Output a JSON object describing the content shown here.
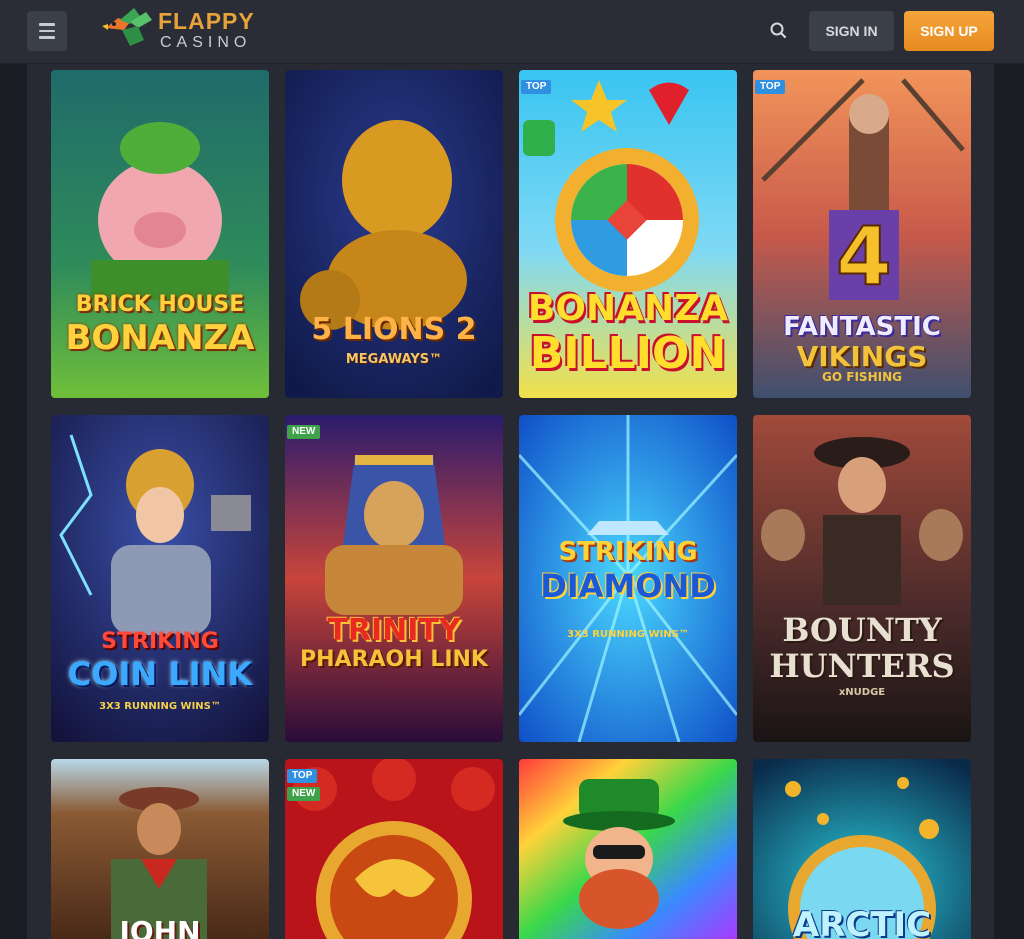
{
  "header": {
    "logo_line1": "FLAPPY",
    "logo_line2": "CASINO",
    "signin_label": "SIGN IN",
    "signup_label": "SIGN UP"
  },
  "colors": {
    "accent": "#f29b2e",
    "badge_top": "#2f8fe0",
    "badge_new": "#3fa14a"
  },
  "games": [
    {
      "line1": "BRICK HOUSE",
      "line2": "BONANZA",
      "sub": "",
      "badges": []
    },
    {
      "line1": "5 LIONS 2",
      "line2": "MEGAWAYS™",
      "sub": "",
      "badges": []
    },
    {
      "line1": "BONANZA",
      "line2": "BILLION",
      "sub": "",
      "badges": [
        "TOP"
      ]
    },
    {
      "line1": "FANTASTIC",
      "line2": "VIKINGS",
      "sub": "GO FISHING",
      "badges": [
        "TOP"
      ]
    },
    {
      "line1": "STRIKING",
      "line2": "COIN LINK",
      "sub": "3X3 RUNNING WINS™",
      "badges": []
    },
    {
      "line1": "TRINITY",
      "line2": "PHARAOH LINK",
      "sub": "",
      "badges": [
        "NEW"
      ]
    },
    {
      "line1": "STRIKING",
      "line2": "DIAMOND",
      "sub": "3X3 RUNNING WINS™",
      "badges": []
    },
    {
      "line1": "BOUNTY",
      "line2": "HUNTERS",
      "sub": "xNUDGE",
      "badges": []
    },
    {
      "line1": "JOHN",
      "line2": "",
      "sub": "",
      "badges": []
    },
    {
      "line1": "",
      "line2": "",
      "sub": "",
      "badges": [
        "TOP",
        "NEW"
      ]
    },
    {
      "line1": "",
      "line2": "",
      "sub": "",
      "badges": []
    },
    {
      "line1": "ARCTIC",
      "line2": "",
      "sub": "",
      "badges": []
    }
  ]
}
